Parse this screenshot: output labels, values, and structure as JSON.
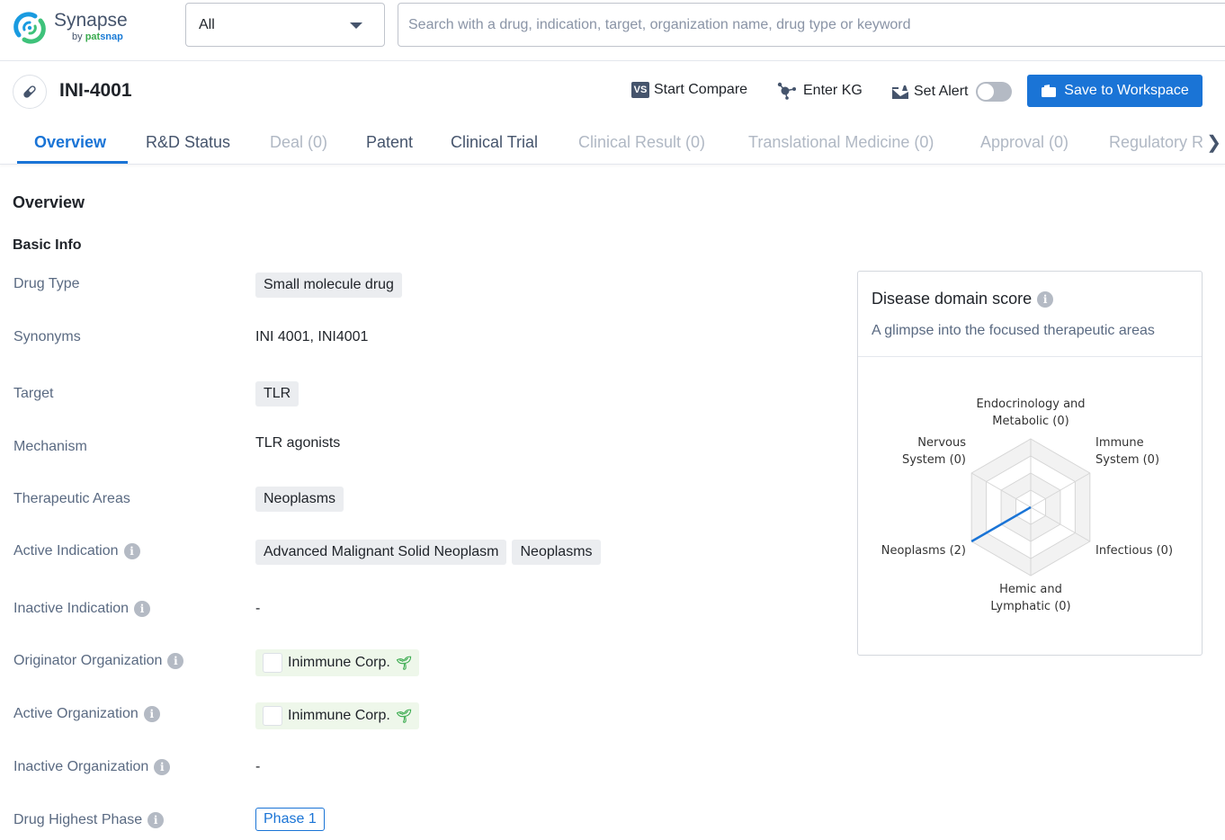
{
  "brand": {
    "name": "Synapse",
    "by": "by",
    "pat": "pat",
    "snap": "snap"
  },
  "search": {
    "scope_value": "All",
    "placeholder": "Search with a drug, indication, target, organization name, drug type or keyword",
    "value": ""
  },
  "drug": {
    "title": "INI-4001",
    "icon": "pill-icon"
  },
  "actions": {
    "compare": "Start Compare",
    "kg": "Enter KG",
    "alert": "Set Alert",
    "alert_on": false,
    "save": "Save to Workspace"
  },
  "tabs": [
    {
      "label": "Overview",
      "state": "active"
    },
    {
      "label": "R&D Status",
      "state": "enabled"
    },
    {
      "label": "Deal (0)",
      "state": "disabled"
    },
    {
      "label": "Patent",
      "state": "enabled"
    },
    {
      "label": "Clinical Trial",
      "state": "enabled"
    },
    {
      "label": "Clinical Result (0)",
      "state": "disabled"
    },
    {
      "label": "Translational Medicine (0)",
      "state": "disabled"
    },
    {
      "label": "Approval (0)",
      "state": "disabled"
    },
    {
      "label": "Regulatory R",
      "state": "disabled"
    }
  ],
  "overview": {
    "heading": "Overview",
    "basic_info": "Basic Info",
    "rows": {
      "drug_type": {
        "label": "Drug Type",
        "chips": [
          "Small molecule drug"
        ]
      },
      "synonyms": {
        "label": "Synonyms",
        "text": "INI 4001,  INI4001"
      },
      "target": {
        "label": "Target",
        "chips": [
          "TLR"
        ]
      },
      "mechanism": {
        "label": "Mechanism",
        "text": "TLR agonists"
      },
      "therapeutic_areas": {
        "label": "Therapeutic Areas",
        "chips": [
          "Neoplasms"
        ]
      },
      "active_indication": {
        "label": "Active Indication",
        "chips": [
          "Advanced Malignant Solid Neoplasm",
          "Neoplasms"
        ]
      },
      "inactive_indication": {
        "label": "Inactive Indication",
        "text": "-"
      },
      "originator_org": {
        "label": "Originator Organization",
        "org": "Inimmune Corp."
      },
      "active_org": {
        "label": "Active Organization",
        "org": "Inimmune Corp."
      },
      "inactive_org": {
        "label": "Inactive Organization",
        "text": "-"
      },
      "highest_phase": {
        "label": "Drug Highest Phase",
        "phase": "Phase 1"
      }
    }
  },
  "score_card": {
    "title": "Disease domain score",
    "subtitle": "A glimpse into the focused therapeutic areas"
  },
  "chart_data": {
    "type": "radar",
    "title": "Disease domain score",
    "axes": [
      {
        "label": [
          "Endocrinology and",
          "Metabolic (0)"
        ],
        "name": "Endocrinology and Metabolic",
        "value": 0
      },
      {
        "label": [
          "Immune",
          "System (0)"
        ],
        "name": "Immune System",
        "value": 0
      },
      {
        "label": [
          "Infectious (0)"
        ],
        "name": "Infectious",
        "value": 0
      },
      {
        "label": [
          "Hemic and",
          "Lymphatic (0)"
        ],
        "name": "Hemic and Lymphatic",
        "value": 0
      },
      {
        "label": [
          "Neoplasms (2)"
        ],
        "name": "Neoplasms",
        "value": 2
      },
      {
        "label": [
          "Nervous",
          "System (0)"
        ],
        "name": "Nervous System",
        "value": 0
      }
    ],
    "max": 2,
    "rings": 4,
    "series_color": "#1a74d6"
  }
}
